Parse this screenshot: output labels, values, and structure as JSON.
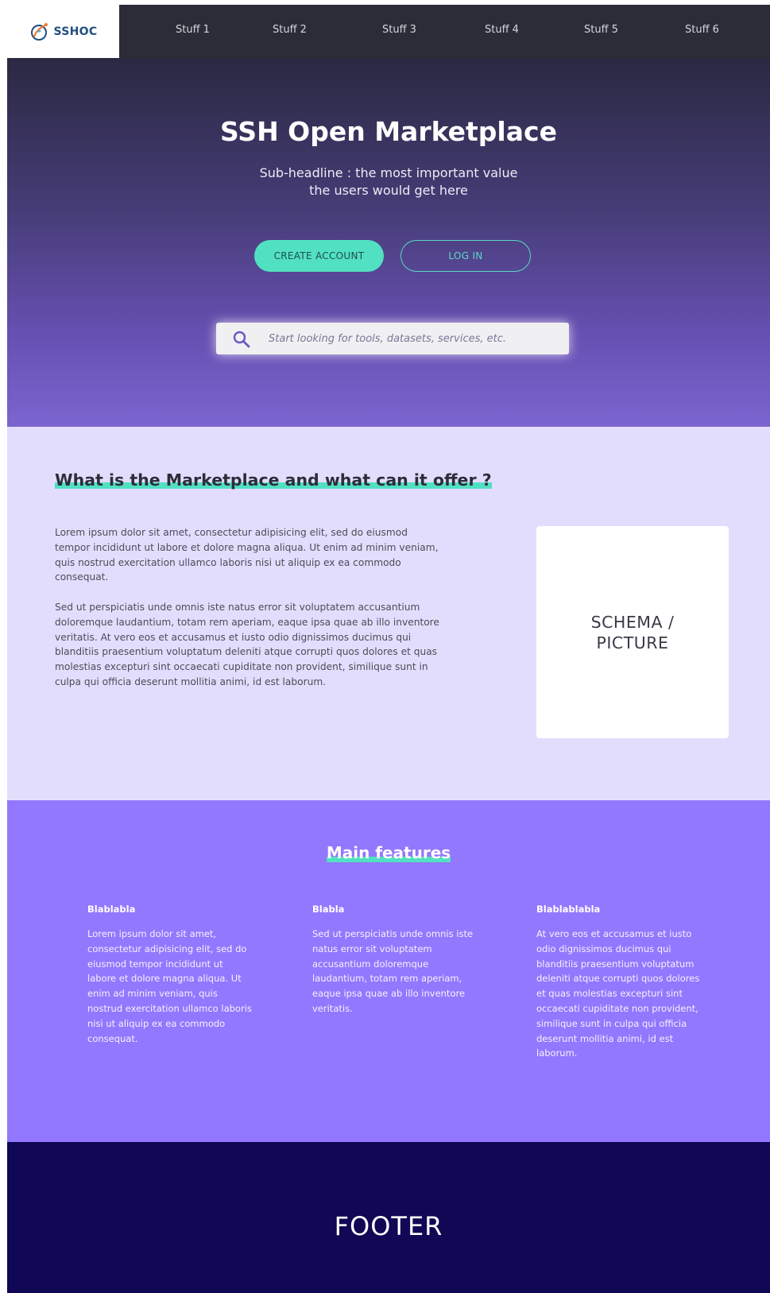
{
  "brand": {
    "name": "SSHOC"
  },
  "nav": {
    "items": [
      "Stuff 1",
      "Stuff 2",
      "Stuff 3",
      "Stuff 4",
      "Stuff 5",
      "Stuff 6"
    ]
  },
  "hero": {
    "title": "SSH Open Marketplace",
    "subtitle_line1": "Sub-headline : the most important value",
    "subtitle_line2": "the users would get here",
    "create_account_label": "CREATE ACCOUNT",
    "login_label": "LOG IN",
    "search_placeholder": "Start looking for tools, datasets, services, etc."
  },
  "about": {
    "title": "What is the Marketplace and what can it offer ?",
    "paragraph1": "Lorem ipsum dolor sit amet, consectetur adipisicing elit, sed do eiusmod tempor incididunt ut labore et dolore magna aliqua. Ut enim ad minim veniam, quis nostrud exercitation ullamco laboris nisi ut aliquip ex ea commodo consequat.",
    "paragraph2": "Sed ut perspiciatis unde omnis iste natus error sit voluptatem accusantium doloremque laudantium, totam rem aperiam, eaque ipsa quae ab illo inventore veritatis. At vero eos et accusamus et iusto odio dignissimos ducimus qui blanditiis praesentium voluptatum deleniti atque corrupti quos dolores et quas molestias excepturi sint occaecati cupiditate non provident, similique sunt in culpa qui officia deserunt mollitia animi, id est laborum.",
    "schema_label": "SCHEMA /\nPICTURE"
  },
  "features": {
    "title": "Main features",
    "columns": [
      {
        "heading": "Blablabla",
        "body": "Lorem ipsum dolor sit amet, consectetur adipisicing elit, sed do eiusmod tempor incididunt ut labore et dolore magna aliqua. Ut enim ad minim veniam, quis nostrud exercitation ullamco laboris nisi ut aliquip ex ea commodo consequat."
      },
      {
        "heading": "Blabla",
        "body": "Sed ut perspiciatis unde omnis iste natus error sit voluptatem accusantium doloremque laudantium, totam rem aperiam, eaque ipsa quae ab illo inventore veritatis."
      },
      {
        "heading": "Blablablabla",
        "body": "At vero eos et accusamus et iusto odio dignissimos ducimus qui blanditiis praesentium voluptatum deleniti atque corrupti quos dolores et quas molestias excepturi sint occaecati cupiditate non provident, similique sunt in culpa qui officia deserunt mollitia animi, id est laborum."
      }
    ]
  },
  "footer": {
    "label": "FOOTER"
  },
  "colors": {
    "accent": "#52e0c2",
    "nav_bg": "#2c2c38",
    "about_bg": "#e3ddfd",
    "features_bg": "#9278fe",
    "footer_bg": "#100855"
  },
  "icons": {
    "search": "search-icon",
    "logo": "sshoc-logo-icon"
  }
}
